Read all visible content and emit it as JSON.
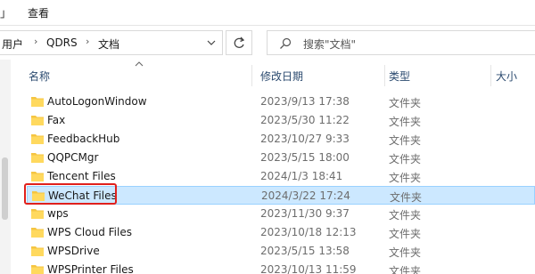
{
  "menu": {
    "left_stub": "」",
    "view_label": "查看"
  },
  "address": {
    "crumbs": [
      "用户",
      "QDRS",
      "文档"
    ],
    "separator": "›"
  },
  "search": {
    "placeholder": "搜索\"文档\""
  },
  "columns": {
    "name": "名称",
    "modified": "修改日期",
    "type": "类型",
    "size": "大小"
  },
  "files": [
    {
      "name": "AutoLogonWindow",
      "modified": "2023/9/13 17:38",
      "type": "文件夹",
      "selected": false
    },
    {
      "name": "Fax",
      "modified": "2023/5/30 11:22",
      "type": "文件夹",
      "selected": false
    },
    {
      "name": "FeedbackHub",
      "modified": "2023/10/27 9:33",
      "type": "文件夹",
      "selected": false
    },
    {
      "name": "QQPCMgr",
      "modified": "2023/5/15 18:00",
      "type": "文件夹",
      "selected": false
    },
    {
      "name": "Tencent Files",
      "modified": "2024/1/3 18:41",
      "type": "文件夹",
      "selected": false
    },
    {
      "name": "WeChat Files",
      "modified": "2024/3/22 17:24",
      "type": "文件夹",
      "selected": true
    },
    {
      "name": "wps",
      "modified": "2023/11/30 9:37",
      "type": "文件夹",
      "selected": false
    },
    {
      "name": "WPS Cloud Files",
      "modified": "2023/10/18 12:13",
      "type": "文件夹",
      "selected": false
    },
    {
      "name": "WPSDrive",
      "modified": "2023/5/15 13:58",
      "type": "文件夹",
      "selected": false
    },
    {
      "name": "WPSPrinter Files",
      "modified": "2023/10/13 11:59",
      "type": "文件夹",
      "selected": false
    }
  ],
  "colors": {
    "selected_bg": "#cce8ff",
    "selected_border": "#99d1ff",
    "highlight": "#e0201c",
    "folder": "#f5c542"
  }
}
